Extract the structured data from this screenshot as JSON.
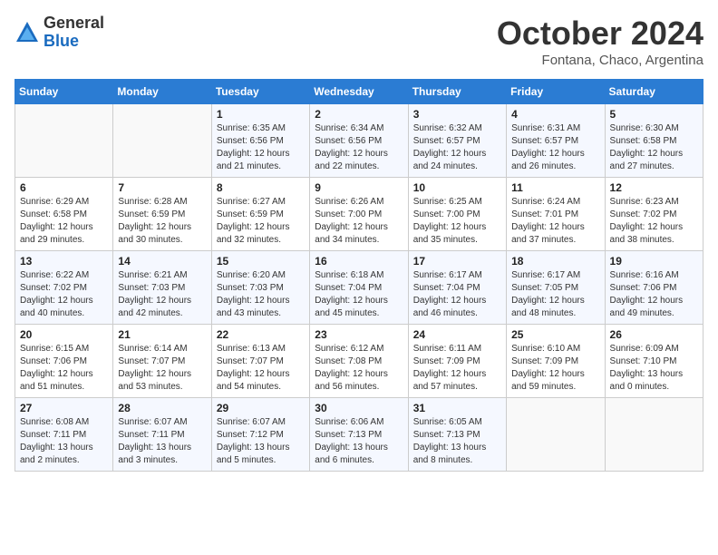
{
  "header": {
    "logo_general": "General",
    "logo_blue": "Blue",
    "month_title": "October 2024",
    "location": "Fontana, Chaco, Argentina"
  },
  "calendar": {
    "days_of_week": [
      "Sunday",
      "Monday",
      "Tuesday",
      "Wednesday",
      "Thursday",
      "Friday",
      "Saturday"
    ],
    "weeks": [
      [
        {
          "day": "",
          "info": ""
        },
        {
          "day": "",
          "info": ""
        },
        {
          "day": "1",
          "info": "Sunrise: 6:35 AM\nSunset: 6:56 PM\nDaylight: 12 hours and 21 minutes."
        },
        {
          "day": "2",
          "info": "Sunrise: 6:34 AM\nSunset: 6:56 PM\nDaylight: 12 hours and 22 minutes."
        },
        {
          "day": "3",
          "info": "Sunrise: 6:32 AM\nSunset: 6:57 PM\nDaylight: 12 hours and 24 minutes."
        },
        {
          "day": "4",
          "info": "Sunrise: 6:31 AM\nSunset: 6:57 PM\nDaylight: 12 hours and 26 minutes."
        },
        {
          "day": "5",
          "info": "Sunrise: 6:30 AM\nSunset: 6:58 PM\nDaylight: 12 hours and 27 minutes."
        }
      ],
      [
        {
          "day": "6",
          "info": "Sunrise: 6:29 AM\nSunset: 6:58 PM\nDaylight: 12 hours and 29 minutes."
        },
        {
          "day": "7",
          "info": "Sunrise: 6:28 AM\nSunset: 6:59 PM\nDaylight: 12 hours and 30 minutes."
        },
        {
          "day": "8",
          "info": "Sunrise: 6:27 AM\nSunset: 6:59 PM\nDaylight: 12 hours and 32 minutes."
        },
        {
          "day": "9",
          "info": "Sunrise: 6:26 AM\nSunset: 7:00 PM\nDaylight: 12 hours and 34 minutes."
        },
        {
          "day": "10",
          "info": "Sunrise: 6:25 AM\nSunset: 7:00 PM\nDaylight: 12 hours and 35 minutes."
        },
        {
          "day": "11",
          "info": "Sunrise: 6:24 AM\nSunset: 7:01 PM\nDaylight: 12 hours and 37 minutes."
        },
        {
          "day": "12",
          "info": "Sunrise: 6:23 AM\nSunset: 7:02 PM\nDaylight: 12 hours and 38 minutes."
        }
      ],
      [
        {
          "day": "13",
          "info": "Sunrise: 6:22 AM\nSunset: 7:02 PM\nDaylight: 12 hours and 40 minutes."
        },
        {
          "day": "14",
          "info": "Sunrise: 6:21 AM\nSunset: 7:03 PM\nDaylight: 12 hours and 42 minutes."
        },
        {
          "day": "15",
          "info": "Sunrise: 6:20 AM\nSunset: 7:03 PM\nDaylight: 12 hours and 43 minutes."
        },
        {
          "day": "16",
          "info": "Sunrise: 6:18 AM\nSunset: 7:04 PM\nDaylight: 12 hours and 45 minutes."
        },
        {
          "day": "17",
          "info": "Sunrise: 6:17 AM\nSunset: 7:04 PM\nDaylight: 12 hours and 46 minutes."
        },
        {
          "day": "18",
          "info": "Sunrise: 6:17 AM\nSunset: 7:05 PM\nDaylight: 12 hours and 48 minutes."
        },
        {
          "day": "19",
          "info": "Sunrise: 6:16 AM\nSunset: 7:06 PM\nDaylight: 12 hours and 49 minutes."
        }
      ],
      [
        {
          "day": "20",
          "info": "Sunrise: 6:15 AM\nSunset: 7:06 PM\nDaylight: 12 hours and 51 minutes."
        },
        {
          "day": "21",
          "info": "Sunrise: 6:14 AM\nSunset: 7:07 PM\nDaylight: 12 hours and 53 minutes."
        },
        {
          "day": "22",
          "info": "Sunrise: 6:13 AM\nSunset: 7:07 PM\nDaylight: 12 hours and 54 minutes."
        },
        {
          "day": "23",
          "info": "Sunrise: 6:12 AM\nSunset: 7:08 PM\nDaylight: 12 hours and 56 minutes."
        },
        {
          "day": "24",
          "info": "Sunrise: 6:11 AM\nSunset: 7:09 PM\nDaylight: 12 hours and 57 minutes."
        },
        {
          "day": "25",
          "info": "Sunrise: 6:10 AM\nSunset: 7:09 PM\nDaylight: 12 hours and 59 minutes."
        },
        {
          "day": "26",
          "info": "Sunrise: 6:09 AM\nSunset: 7:10 PM\nDaylight: 13 hours and 0 minutes."
        }
      ],
      [
        {
          "day": "27",
          "info": "Sunrise: 6:08 AM\nSunset: 7:11 PM\nDaylight: 13 hours and 2 minutes."
        },
        {
          "day": "28",
          "info": "Sunrise: 6:07 AM\nSunset: 7:11 PM\nDaylight: 13 hours and 3 minutes."
        },
        {
          "day": "29",
          "info": "Sunrise: 6:07 AM\nSunset: 7:12 PM\nDaylight: 13 hours and 5 minutes."
        },
        {
          "day": "30",
          "info": "Sunrise: 6:06 AM\nSunset: 7:13 PM\nDaylight: 13 hours and 6 minutes."
        },
        {
          "day": "31",
          "info": "Sunrise: 6:05 AM\nSunset: 7:13 PM\nDaylight: 13 hours and 8 minutes."
        },
        {
          "day": "",
          "info": ""
        },
        {
          "day": "",
          "info": ""
        }
      ]
    ]
  }
}
